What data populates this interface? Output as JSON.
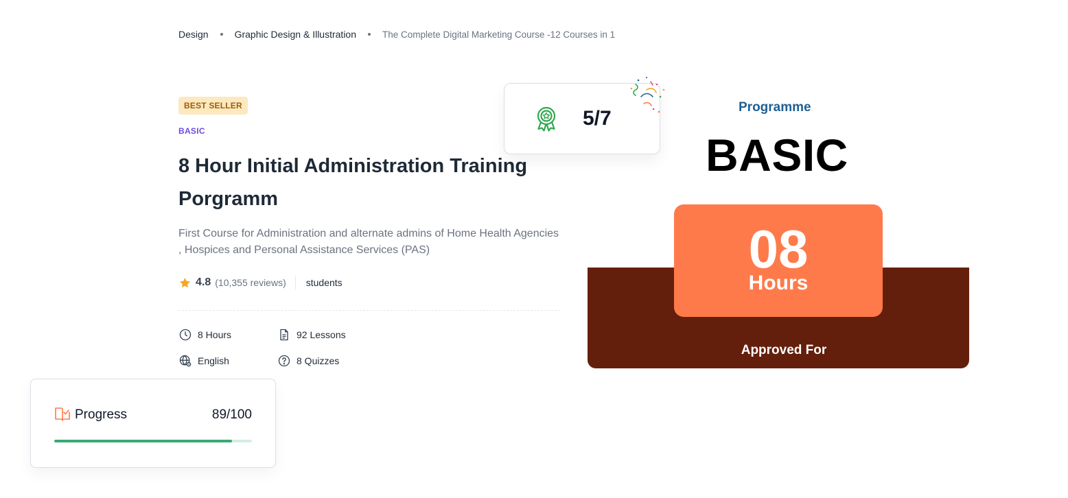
{
  "breadcrumb": {
    "items": [
      "Design",
      "Graphic Design & Illustration",
      "The Complete Digital Marketing Course -12 Courses in 1"
    ]
  },
  "course": {
    "badge": "BEST SELLER",
    "level_tag": "BASIC",
    "title": "8 Hour Initial Administration Training Porgramm",
    "description": "First Course for Administration and alternate admins of Home Health Agencies , Hospices and Personal Assistance Services (PAS)",
    "rating": "4.8",
    "reviews": "(10,355 reviews)",
    "students": "students",
    "meta": {
      "duration": "8 Hours",
      "lessons": "92 Lessons",
      "language": "English",
      "quizzes": "8 Quizzes"
    }
  },
  "award": {
    "count": "5/7",
    "icon": "award-ribbon-icon"
  },
  "banner": {
    "programme_label": "Programme",
    "level": "BASIC",
    "hours_number": "08",
    "hours_label": "Hours",
    "approved_label": "Approved For"
  },
  "progress": {
    "label": "Progress",
    "value": "89/100",
    "fraction": 0.9
  },
  "colors": {
    "accent_purple": "#6d4de0",
    "award_green": "#2fa84f",
    "banner_orange": "#ff7a4b",
    "banner_brown": "#641f0c",
    "programme_blue": "#1f5f93",
    "progress_green": "#3aa876",
    "star_yellow": "#f5a623"
  }
}
